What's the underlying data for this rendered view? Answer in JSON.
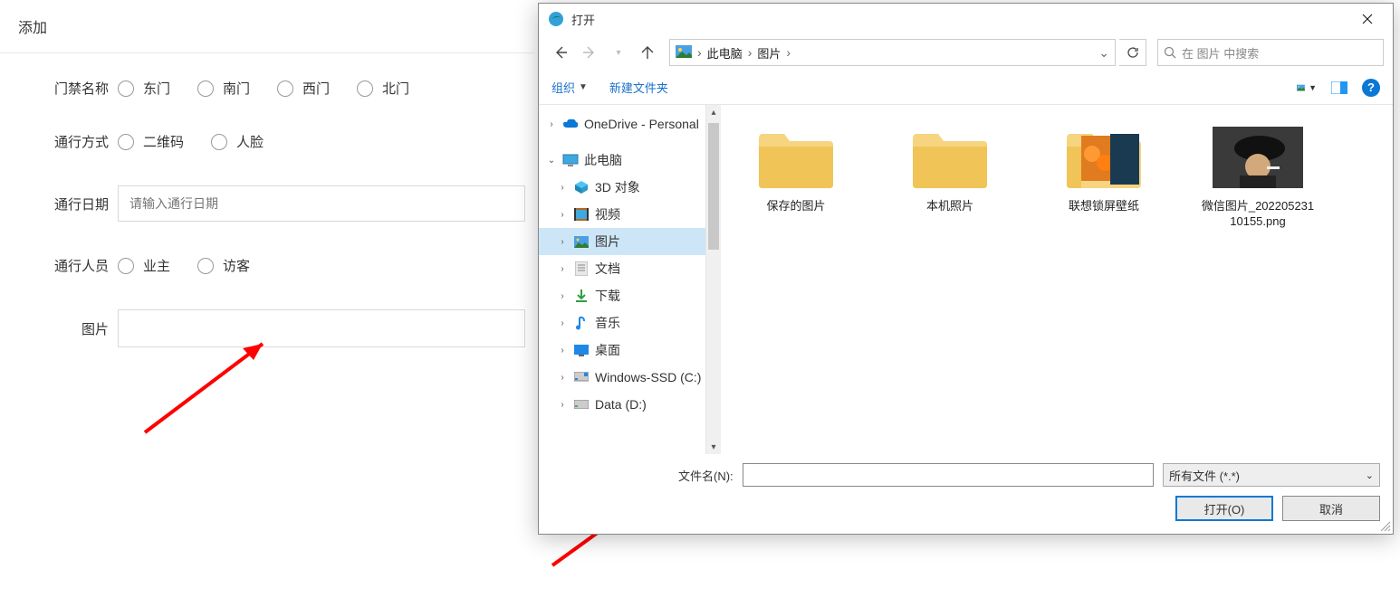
{
  "form": {
    "title": "添加",
    "rows": {
      "gate": {
        "label": "门禁名称",
        "options": [
          "东门",
          "南门",
          "西门",
          "北门"
        ]
      },
      "method": {
        "label": "通行方式",
        "options": [
          "二维码",
          "人脸"
        ]
      },
      "date": {
        "label": "通行日期",
        "placeholder": "请输入通行日期"
      },
      "person": {
        "label": "通行人员",
        "options": [
          "业主",
          "访客"
        ]
      },
      "picture": {
        "label": "图片"
      }
    }
  },
  "dialog": {
    "title": "打开",
    "breadcrumb": {
      "root": "此电脑",
      "folder": "图片"
    },
    "search_placeholder": "在 图片 中搜索",
    "toolbar": {
      "organize": "组织",
      "new_folder": "新建文件夹"
    },
    "tree": {
      "onedrive": "OneDrive - Personal",
      "this_pc": "此电脑",
      "children": [
        "3D 对象",
        "视频",
        "图片",
        "文档",
        "下载",
        "音乐",
        "桌面",
        "Windows-SSD (C:)",
        "Data (D:)"
      ],
      "selected_index": 2
    },
    "files": [
      {
        "name": "保存的图片",
        "type": "folder"
      },
      {
        "name": "本机照片",
        "type": "folder"
      },
      {
        "name": "联想锁屏壁纸",
        "type": "folder_preview"
      },
      {
        "name": "微信图片_20220523110155.png",
        "type": "image"
      }
    ],
    "footer": {
      "filename_label": "文件名(N):",
      "filetype": "所有文件 (*.*)",
      "open": "打开(O)",
      "cancel": "取消"
    }
  }
}
